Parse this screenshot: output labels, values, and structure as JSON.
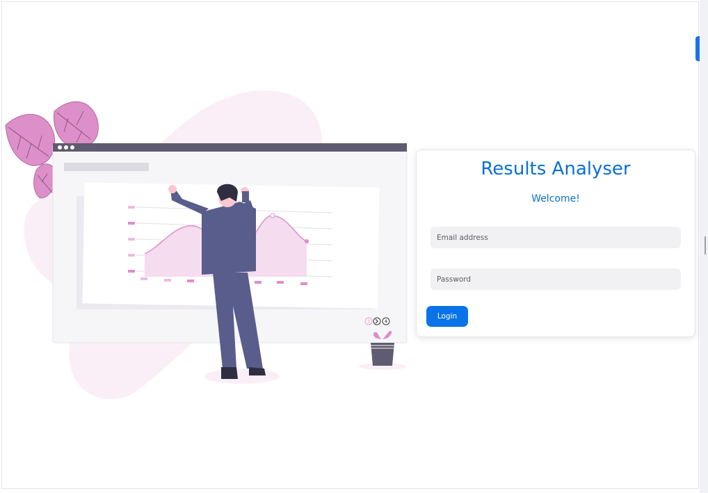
{
  "login": {
    "title": "Results Analyser",
    "welcome": "Welcome!",
    "email_placeholder": "Email address",
    "password_placeholder": "Password",
    "login_label": "Login"
  },
  "illustration": {
    "carousel_indicators": [
      "3",
      "4"
    ]
  },
  "colors": {
    "accent": "#0a73e8",
    "title": "#0a6fd6",
    "leaf": "#dd8fc9",
    "figure": "#595d8c",
    "window_bar": "#5f5b70"
  }
}
